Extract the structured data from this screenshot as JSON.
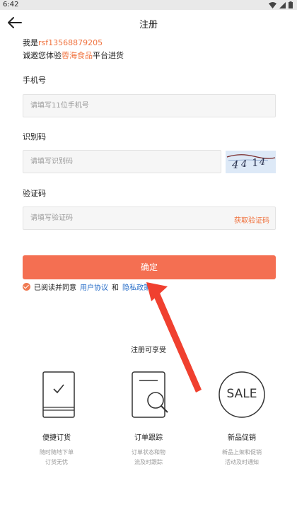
{
  "status_bar": {
    "time": "6:42"
  },
  "header": {
    "title": "注册",
    "back_icon": "arrow-left-icon"
  },
  "intro": {
    "line1_prefix": "我是",
    "account": "rsf13568879205",
    "line2_prefix": "诚邀您体验",
    "brand": "蓉海食品",
    "line2_suffix": "平台进货"
  },
  "form": {
    "phone_label": "手机号",
    "phone_placeholder": "请填写11位手机号",
    "captcha_label": "识别码",
    "captcha_placeholder": "请填写识别码",
    "code_label": "验证码",
    "code_placeholder": "请填写验证码",
    "get_code_label": "获取验证码"
  },
  "confirm_label": "确定",
  "agreement": {
    "prefix": "已阅读并同意",
    "terms": "用户协议",
    "and": "和",
    "privacy": "隐私政策"
  },
  "benefits": {
    "title": "注册可享受",
    "items": [
      {
        "title": "便捷订货",
        "line1": "随时随地下单",
        "line2": "订货无忧"
      },
      {
        "title": "订单跟踪",
        "line1": "订单状态和物",
        "line2": "流及时跟踪"
      },
      {
        "title": "新品促销",
        "line1": "新品上架和促销",
        "line2": "活动及时通知",
        "badge": "SALE"
      }
    ]
  },
  "colors": {
    "accent": "#f0723e",
    "button": "#f46f52",
    "link": "#2a6fc9",
    "annotation_arrow": "#f0402f"
  }
}
